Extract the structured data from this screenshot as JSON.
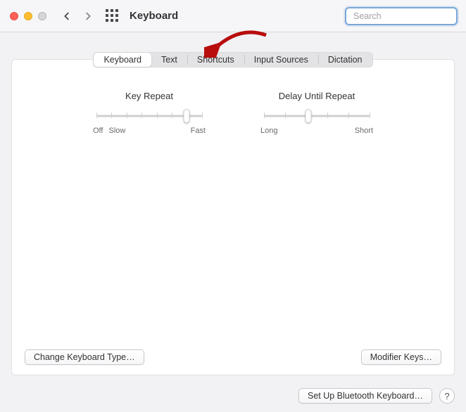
{
  "window": {
    "title": "Keyboard",
    "search_placeholder": "Search"
  },
  "tabs": [
    {
      "label": "Keyboard",
      "active": true
    },
    {
      "label": "Text",
      "active": false
    },
    {
      "label": "Shortcuts",
      "active": false
    },
    {
      "label": "Input Sources",
      "active": false
    },
    {
      "label": "Dictation",
      "active": false
    }
  ],
  "sliders": {
    "key_repeat": {
      "title": "Key Repeat",
      "left_label1": "Off",
      "left_label2": "Slow",
      "right_label": "Fast",
      "ticks": 8,
      "position_pct": 85
    },
    "delay_repeat": {
      "title": "Delay Until Repeat",
      "left_label": "Long",
      "right_label": "Short",
      "ticks": 6,
      "position_pct": 42
    }
  },
  "buttons": {
    "change_type": "Change Keyboard Type…",
    "modifier_keys": "Modifier Keys…",
    "bluetooth": "Set Up Bluetooth Keyboard…",
    "help": "?"
  },
  "annotation": {
    "arrow_color": "#b80d0d"
  }
}
